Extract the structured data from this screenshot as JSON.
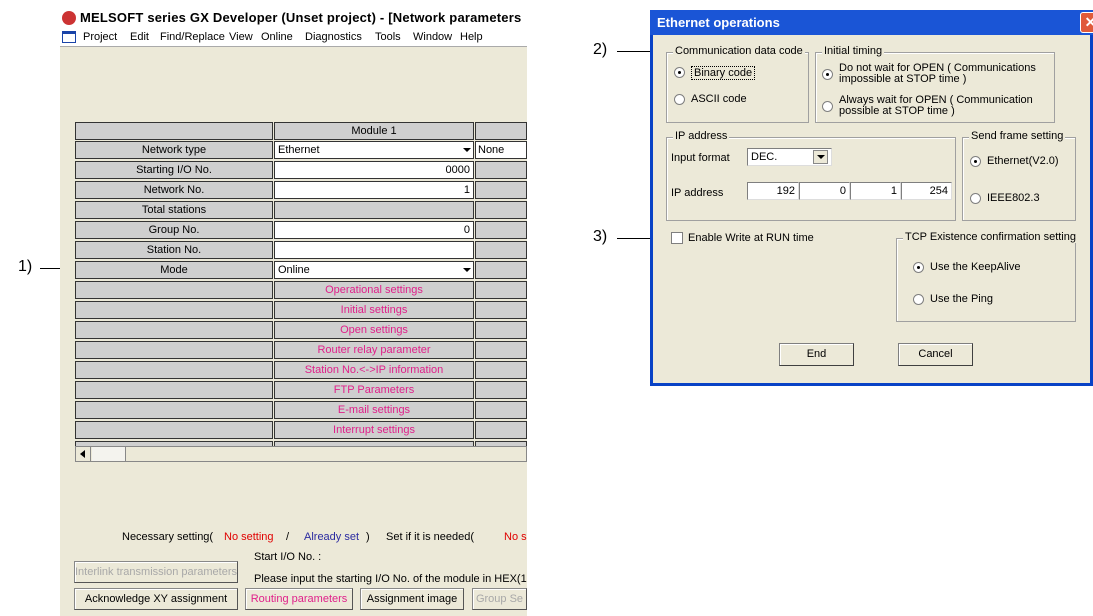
{
  "gx_window": {
    "title": "MELSOFT series GX Developer (Unset project) - [Network parameters",
    "menu": [
      "Project",
      "Edit",
      "Find/Replace",
      "View",
      "Online",
      "Diagnostics",
      "Tools",
      "Window",
      "Help"
    ],
    "grid": {
      "column_header": "Module 1",
      "rows": [
        {
          "label": "Network type",
          "value": "Ethernet",
          "kind": "combo",
          "col3": "None"
        },
        {
          "label": "Starting I/O No.",
          "value": "0000",
          "kind": "right"
        },
        {
          "label": "Network No.",
          "value": "1",
          "kind": "right"
        },
        {
          "label": "Total stations",
          "value": "",
          "kind": "gray"
        },
        {
          "label": "Group No.",
          "value": "0",
          "kind": "right"
        },
        {
          "label": "Station No.",
          "value": "",
          "kind": "text"
        },
        {
          "label": "Mode",
          "value": "Online",
          "kind": "combo"
        },
        {
          "label": "",
          "value": "Operational settings",
          "kind": "button"
        },
        {
          "label": "",
          "value": "Initial settings",
          "kind": "button"
        },
        {
          "label": "",
          "value": "Open settings",
          "kind": "button"
        },
        {
          "label": "",
          "value": "Router relay parameter",
          "kind": "button"
        },
        {
          "label": "",
          "value": "Station No.<->IP information",
          "kind": "button"
        },
        {
          "label": "",
          "value": "FTP Parameters",
          "kind": "button"
        },
        {
          "label": "",
          "value": "E-mail settings",
          "kind": "button"
        },
        {
          "label": "",
          "value": "Interrupt settings",
          "kind": "button"
        },
        {
          "label": "",
          "value": "",
          "kind": "gray"
        }
      ]
    },
    "legend": {
      "necessary": "Necessary setting(",
      "no_setting": "No setting",
      "slash": "/",
      "already_set": "Already set",
      "close": ")",
      "if_needed": "Set if it is needed(",
      "no_s": "No s"
    },
    "start_io_label": "Start I/O No. :",
    "hint": "Please input the starting I/O No. of the module in HEX(1",
    "buttons": {
      "interlink": "Interlink transmission parameters",
      "ack_xy": "Acknowledge XY assignment",
      "routing": "Routing parameters",
      "assignment": "Assignment image",
      "group": "Group Se"
    },
    "colors": {
      "pink": "#e0208a",
      "red": "#e00000",
      "blue": "#2a2aa0"
    }
  },
  "callouts": {
    "one": "1)",
    "two": "2)",
    "three": "3)"
  },
  "eth_dialog": {
    "title": "Ethernet operations",
    "comm_code": {
      "legend": "Communication data code",
      "binary": "Binary code",
      "ascii": "ASCII code",
      "selected": "binary"
    },
    "initial_timing": {
      "legend": "Initial timing",
      "opt1": "Do not wait for OPEN ( Communications impossible at STOP time )",
      "opt2": "Always wait for OPEN ( Communication possible at STOP time )"
    },
    "ip": {
      "legend": "IP address",
      "input_format_label": "Input format",
      "input_format_value": "DEC.",
      "ip_label": "IP address",
      "octets": [
        "192",
        "0",
        "1",
        "254"
      ]
    },
    "send_frame": {
      "legend": "Send frame setting",
      "ethernet": "Ethernet(V2.0)",
      "ieee": "IEEE802.3"
    },
    "write_run": "Enable Write at RUN time",
    "tcp": {
      "legend": "TCP Existence confirmation setting",
      "keepalive": "Use the KeepAlive",
      "ping": "Use the Ping"
    },
    "end": "End",
    "cancel": "Cancel"
  }
}
